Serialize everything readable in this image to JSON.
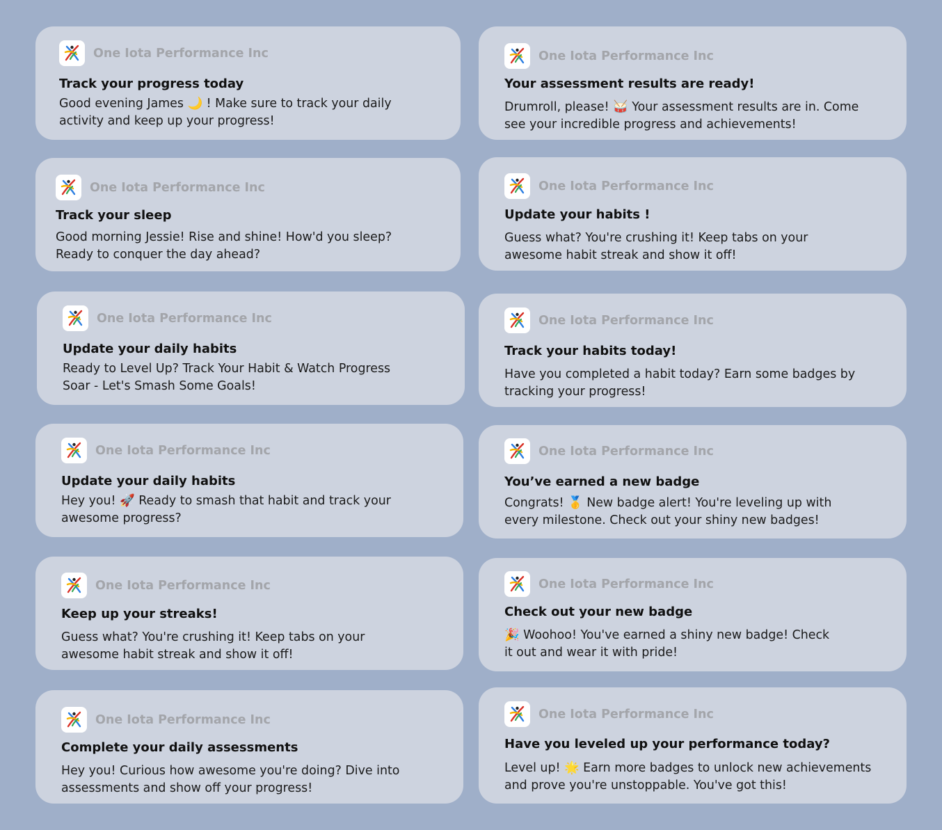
{
  "colors": {
    "background": "#9fafc9",
    "card": "#cdd3df",
    "app_name": "#a3a5aa"
  },
  "app_icon": "one-iota-logo-icon",
  "notifications": [
    {
      "app": "One Iota Performance Inc",
      "title": "Track your progress today",
      "body": "Good evening James 🌙 ! Make sure to track your daily activity and keep up your progress!"
    },
    {
      "app": "One Iota Performance Inc",
      "title": "Your assessment results are ready!",
      "body": "Drumroll, please! 🥁 Your assessment results are in. Come see your incredible progress and achievements!"
    },
    {
      "app": "One Iota Performance Inc",
      "title": "Track your sleep",
      "body": "Good morning Jessie! Rise and shine! How'd you sleep? Ready to conquer the day ahead?"
    },
    {
      "app": "One Iota Performance Inc",
      "title": "Update your habits !",
      "body": "Guess what? You're crushing it! Keep tabs on your awesome habit streak and show it off!"
    },
    {
      "app": "One Iota Performance Inc",
      "title": "Update your daily habits",
      "body": "Ready to Level Up? Track Your Habit & Watch Progress Soar - Let's Smash Some Goals!"
    },
    {
      "app": "One Iota Performance Inc",
      "title": "Track your habits today!",
      "body": "Have you completed a habit today? Earn some badges by tracking your progress!"
    },
    {
      "app": "One Iota Performance Inc",
      "title": "Update your daily habits",
      "body": "Hey you! 🚀 Ready to smash that habit and track your awesome progress?"
    },
    {
      "app": "One Iota Performance Inc",
      "title": "You’ve earned a new badge",
      "body": "Congrats! 🥇 New badge alert! You're leveling up with every milestone. Check out your shiny new badges!"
    },
    {
      "app": "One Iota Performance Inc",
      "title": "Keep up your streaks!",
      "body": "Guess what? You're crushing it! Keep tabs on your awesome habit streak and show it off!"
    },
    {
      "app": "One Iota Performance Inc",
      "title": "Check out your new badge",
      "body": "🎉 Woohoo! You've earned a shiny new badge! Check it out and wear it with pride!"
    },
    {
      "app": "One Iota Performance Inc",
      "title": "Complete your daily assessments",
      "body": "Hey you! Curious how awesome you're doing? Dive into assessments and show off your progress!"
    },
    {
      "app": "One Iota Performance Inc",
      "title": "Have you leveled up your performance today?",
      "body": "Level up! 🌟 Earn more badges to unlock new achievements and prove you're unstoppable. You've got this!"
    }
  ]
}
